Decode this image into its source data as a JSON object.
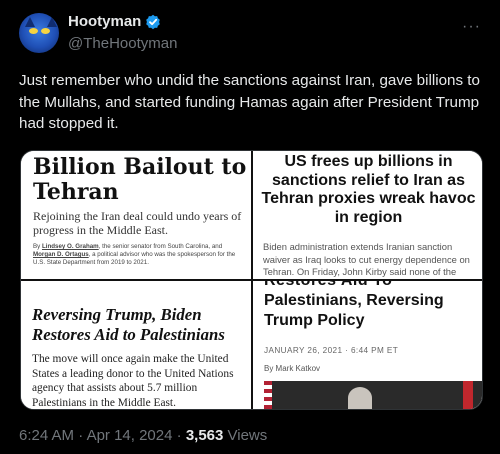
{
  "author": {
    "name": "Hootyman",
    "handle": "@TheHootyman",
    "verified": true,
    "avatar_icon": "owl-avatar-icon"
  },
  "more_icon_glyph": "···",
  "tweet": {
    "text": "Just remember who undid the sanctions against Iran, gave billions to the Mullahs, and started funding Hamas again after President Trump had stopped it."
  },
  "media": {
    "panel1": {
      "headline_line1": "Billion Bailout to",
      "headline_line2": "Tehran",
      "subhead": "Rejoining the Iran deal could undo years of progress in the Middle East.",
      "byline_by": "By ",
      "byline_author1": "Lindsey O. Graham",
      "byline_mid": ", the senior senator from South Carolina, and ",
      "byline_author2": "Morgan D. Ortagus",
      "byline_end": ", a political advisor who was the spokesperson for the U.S. State Department from 2019 to 2021."
    },
    "panel2": {
      "headline": "US frees up billions in sanctions relief to Iran as Tehran proxies wreak havoc in region",
      "body": "Biden administration extends Iranian sanction waiver as Iraq looks to cut energy dependence on Tehran. On Friday, John Kirby said none of the money will be"
    },
    "panel3": {
      "headline": "Reversing Trump, Biden Restores Aid to Palestinians",
      "body": "The move will once again make the United States a leading donor to the United Nations agency that assists about 5.7 million Palestinians in the Middle East."
    },
    "panel4": {
      "cut_headline": "Restores Aid To",
      "headline": "Palestinians, Reversing Trump Policy",
      "date": "JANUARY 26, 2021 · 6:44 PM ET",
      "author": "By Mark Katkov"
    }
  },
  "meta": {
    "time": "6:24 AM",
    "sep1": " · ",
    "date": "Apr 14, 2024",
    "sep2": " · ",
    "views_count": "3,563",
    "views_label": " Views"
  },
  "colors": {
    "background": "#000000",
    "text": "#e7e9ea",
    "secondary": "#71767b",
    "verified": "#1d9bf0"
  }
}
